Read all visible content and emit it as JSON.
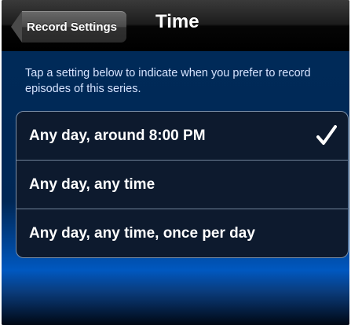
{
  "navbar": {
    "back_label": "Record Settings",
    "title": "Time"
  },
  "instructions": "Tap a setting below to indicate when you prefer to record episodes of this series.",
  "options": [
    {
      "label": "Any day, around 8:00 PM",
      "selected": true
    },
    {
      "label": "Any day, any time",
      "selected": false
    },
    {
      "label": "Any day, any time, once per day",
      "selected": false
    }
  ],
  "icons": {
    "back": "left-arrow-back-icon",
    "selected": "checkmark-icon"
  },
  "colors": {
    "background_blue": "#002755",
    "accent_blue": "#0058c0",
    "text_white": "#ffffff"
  }
}
